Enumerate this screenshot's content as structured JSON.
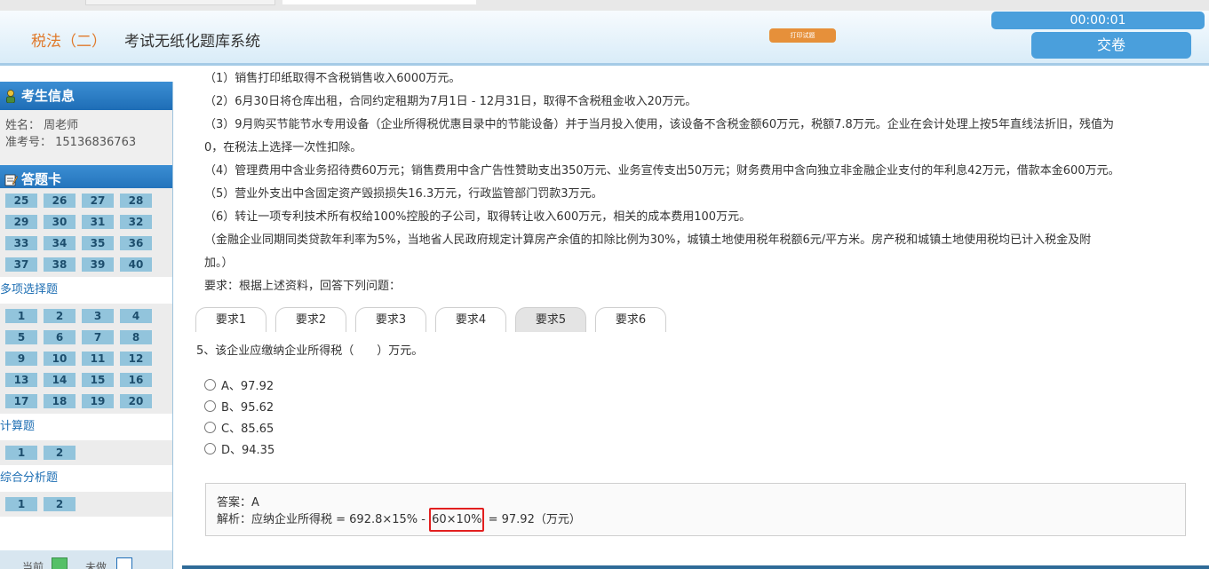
{
  "header": {
    "subject": "税法（二）",
    "system_title": "考试无纸化题库系统",
    "print_label": "打印试题",
    "timer": "00:00:01",
    "submit_label": "交卷"
  },
  "sidebar": {
    "candidate_title": "考生信息",
    "name_line": "姓名： 周老师",
    "id_line": "准考号： 15136836763",
    "answer_card_title": "答题卡",
    "single_rows": [
      [
        "25",
        "26",
        "27",
        "28"
      ],
      [
        "29",
        "30",
        "31",
        "32"
      ],
      [
        "33",
        "34",
        "35",
        "36"
      ],
      [
        "37",
        "38",
        "39",
        "40"
      ]
    ],
    "multi_title": "多项选择题",
    "multi_rows": [
      [
        "1",
        "2",
        "3",
        "4"
      ],
      [
        "5",
        "6",
        "7",
        "8"
      ],
      [
        "9",
        "10",
        "11",
        "12"
      ],
      [
        "13",
        "14",
        "15",
        "16"
      ],
      [
        "17",
        "18",
        "19",
        "20"
      ]
    ],
    "calc_title": "计算题",
    "calc_row": [
      "1",
      "2"
    ],
    "comp_title": "综合分析题",
    "comp_row": [
      "1",
      "2"
    ],
    "legend_current": "当前",
    "legend_undone": "未做"
  },
  "content": {
    "lines": [
      "（1）销售打印纸取得不含税销售收入6000万元。",
      "（2）6月30日将仓库出租，合同约定租期为7月1日 - 12月31日，取得不含税租金收入20万元。",
      "（3）9月购买节能节水专用设备（企业所得税优惠目录中的节能设备）并于当月投入使用，该设备不含税金额60万元，税额7.8万元。企业在会计处理上按5年直线法折旧，残值为",
      "0，在税法上选择一次性扣除。",
      "（4）管理费用中含业务招待费60万元；销售费用中含广告性赞助支出350万元、业务宣传支出50万元；财务费用中含向独立非金融企业支付的年利息42万元，借款本金600万元。",
      "（5）营业外支出中含固定资产毁损损失16.3万元，行政监管部门罚款3万元。",
      "（6）转让一项专利技术所有权给100%控股的子公司，取得转让收入600万元，相关的成本费用100万元。",
      "（金融企业同期同类贷款年利率为5%，当地省人民政府规定计算房产余值的扣除比例为30%，城镇土地使用税年税额6元/平方米。房产税和城镇土地使用税均已计入税金及附",
      "加。）",
      "要求：根据上述资料，回答下列问题："
    ],
    "tabs": [
      "要求1",
      "要求2",
      "要求3",
      "要求4",
      "要求5",
      "要求6"
    ],
    "active_tab": "要求5",
    "question": "5、该企业应缴纳企业所得税（　　）万元。",
    "options": [
      "A、97.92",
      "B、95.62",
      "C、85.65",
      "D、94.35"
    ],
    "answer_line": "答案：A",
    "analysis_prefix": "解析：应纳企业所得税 = 692.8×15% - ",
    "analysis_highlight": "60×10%",
    "analysis_suffix": " = 97.92（万元）"
  }
}
